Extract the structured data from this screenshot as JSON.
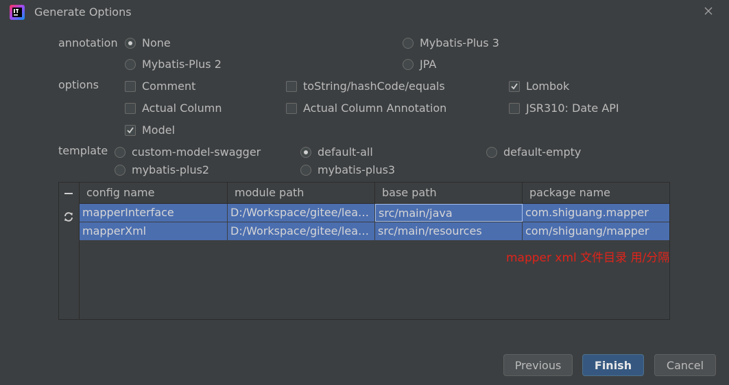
{
  "window": {
    "title": "Generate Options",
    "close_icon": "close-icon"
  },
  "annotation": {
    "label": "annotation",
    "options": [
      "None",
      "Mybatis-Plus 3",
      "Mybatis-Plus 2",
      "JPA"
    ],
    "selected": "None"
  },
  "options": {
    "label": "options",
    "items": [
      {
        "label": "Comment",
        "checked": false
      },
      {
        "label": "toString/hashCode/equals",
        "checked": false
      },
      {
        "label": "Lombok",
        "checked": true
      },
      {
        "label": "Actual Column",
        "checked": false
      },
      {
        "label": "Actual Column Annotation",
        "checked": false
      },
      {
        "label": "JSR310: Date API",
        "checked": false
      },
      {
        "label": "Model",
        "checked": true
      }
    ]
  },
  "template": {
    "label": "template",
    "options": [
      "custom-model-swagger",
      "default-all",
      "default-empty",
      "mybatis-plus2",
      "mybatis-plus3"
    ],
    "selected": "default-all"
  },
  "table": {
    "toolbar": {
      "remove_icon": "minus-icon",
      "refresh_icon": "refresh-icon"
    },
    "headers": [
      "config name",
      "module path",
      "base path",
      "package name"
    ],
    "rows": [
      [
        "mapperInterface",
        "D:/Workspace/gitee/lear...",
        "src/main/java",
        "com.shiguang.mapper"
      ],
      [
        "mapperXml",
        "D:/Workspace/gitee/lear...",
        "src/main/resources",
        "com/shiguang/mapper"
      ]
    ]
  },
  "note": "mapper xml 文件目录 用/分隔",
  "buttons": {
    "previous": "Previous",
    "finish": "Finish",
    "cancel": "Cancel"
  },
  "colors": {
    "background": "#3c3f41",
    "selection": "#4b6eaf",
    "primary_button": "#365880",
    "note": "#e2231a"
  }
}
